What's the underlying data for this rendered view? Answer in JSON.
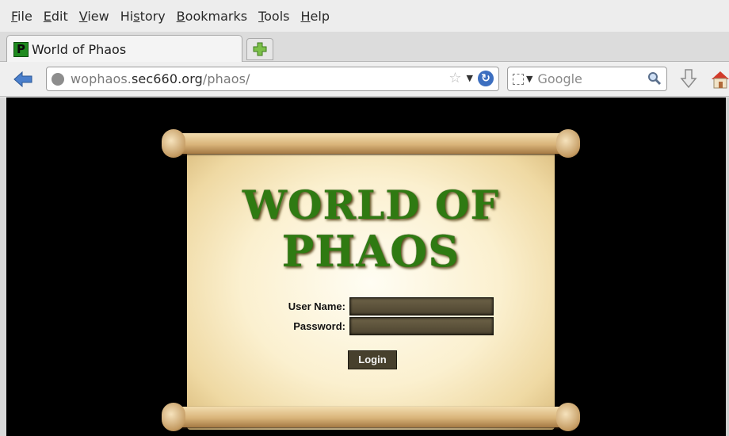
{
  "menu": [
    {
      "pre": "",
      "acc": "F",
      "post": "ile"
    },
    {
      "pre": "",
      "acc": "E",
      "post": "dit"
    },
    {
      "pre": "",
      "acc": "V",
      "post": "iew"
    },
    {
      "pre": "Hi",
      "acc": "s",
      "post": "tory"
    },
    {
      "pre": "",
      "acc": "B",
      "post": "ookmarks"
    },
    {
      "pre": "",
      "acc": "T",
      "post": "ools"
    },
    {
      "pre": "",
      "acc": "H",
      "post": "elp"
    }
  ],
  "tab": {
    "title": "World of Phaos",
    "favicon_letter": "P"
  },
  "url": {
    "prefix": "wophaos.",
    "host": "sec660.org",
    "path": "/phaos/"
  },
  "search": {
    "placeholder": "Google"
  },
  "page": {
    "title_line1": "WORLD OF",
    "title_line2": "PHAOS",
    "username_label": "User Name:",
    "password_label": "Password:",
    "username_value": "",
    "password_value": "",
    "login_label": "Login"
  },
  "colors": {
    "title_green": "#2f7a12",
    "reload_blue": "#3d6fc0",
    "favicon_green": "#1f8a1f"
  },
  "icons": [
    "back-arrow-icon",
    "globe-icon",
    "bookmark-star-icon",
    "dropdown-icon",
    "reload-icon",
    "search-engine-icon",
    "magnifier-icon",
    "download-icon",
    "home-icon",
    "plus-icon"
  ]
}
